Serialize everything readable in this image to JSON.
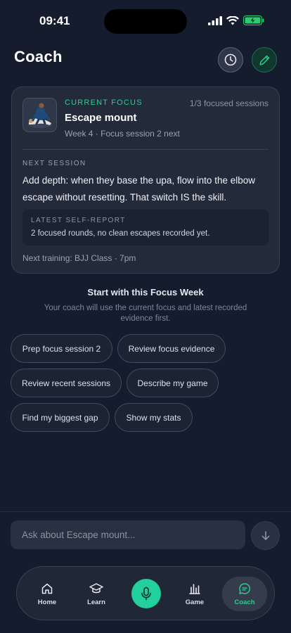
{
  "status_bar": {
    "time": "09:41"
  },
  "header": {
    "title": "Coach",
    "history_icon": "clock-icon",
    "edit_icon": "pencil-icon"
  },
  "focus_card": {
    "label": "CURRENT FOCUS",
    "sessions": "1/3 focused sessions",
    "title": "Escape mount",
    "subtitle": "Week 4 · Focus session 2 next",
    "next_label": "NEXT SESSION",
    "next_text": "Add depth: when they base the upa, flow into the elbow escape without resetting. That switch IS the skill.",
    "report_label": "LATEST SELF-REPORT",
    "report_text": "2 focused rounds, no clean escapes recorded yet.",
    "next_training": "Next training: BJJ Class · 7pm"
  },
  "start": {
    "title": "Start with this Focus Week",
    "subtitle": "Your coach will use the current focus and latest recorded evidence first."
  },
  "chips": [
    "Prep focus session 2",
    "Review focus evidence",
    "Review recent sessions",
    "Describe my game",
    "Find my biggest gap",
    "Show my stats"
  ],
  "input": {
    "placeholder": "Ask about Escape mount..."
  },
  "nav": {
    "items": [
      {
        "label": "Home",
        "icon": "home-icon"
      },
      {
        "label": "Learn",
        "icon": "graduation-cap-icon"
      },
      {
        "label": "",
        "icon": "microphone-icon"
      },
      {
        "label": "Game",
        "icon": "bar-chart-icon"
      },
      {
        "label": "Coach",
        "icon": "chat-bubble-icon"
      }
    ],
    "active": "Coach"
  },
  "colors": {
    "accent": "#2ecc8f",
    "background": "#141c2e",
    "card": "#232b3b"
  }
}
